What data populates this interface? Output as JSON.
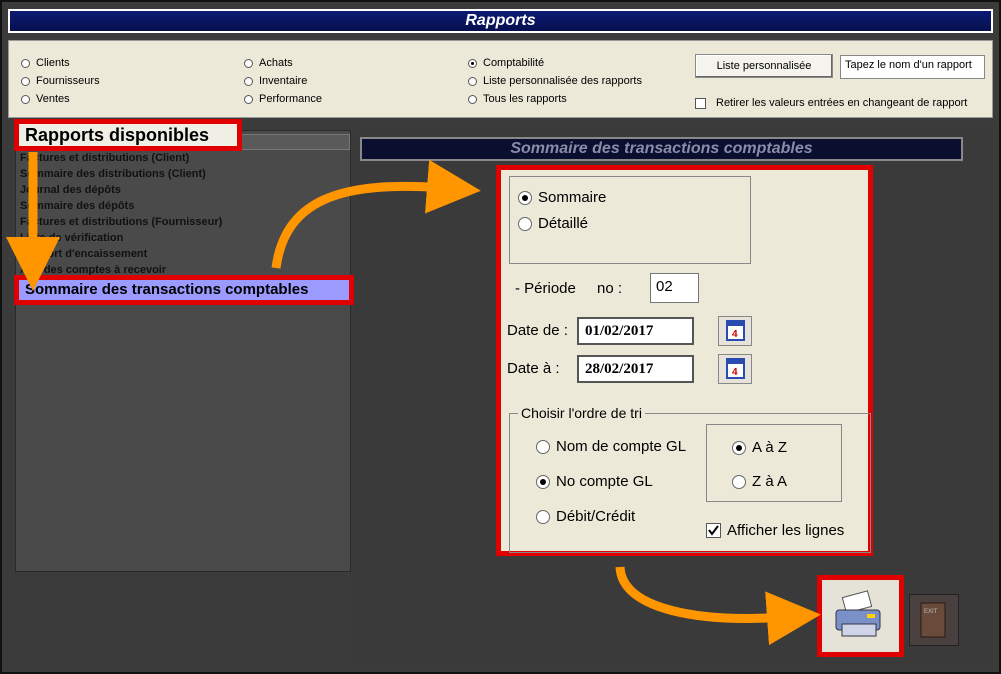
{
  "window": {
    "title": "Rapports"
  },
  "report_types": {
    "col1": [
      "Clients",
      "Fournisseurs",
      "Ventes"
    ],
    "col2": [
      "Achats",
      "Inventaire",
      "Performance"
    ],
    "col3": [
      "Comptabilité",
      "Liste personnalisée des rapports",
      "Tous les rapports"
    ],
    "selected": "Comptabilité"
  },
  "toolbar": {
    "liste_label": "Liste personnalisée",
    "input_value": "Tapez le nom d'un rapport",
    "retirer_label": "Retirer les valeurs entrées en changeant de rapport"
  },
  "reports": {
    "heading": "Rapports disponibles",
    "items": [
      "Factures et distributions (Client)",
      "Sommaire des distributions (Client)",
      "Journal des dépôts",
      "Sommaire des dépôts",
      "Factures et distributions (Fournisseur)",
      "Liste de vérification",
      "Rapport d'encaissement",
      "Âge des comptes à recevoir"
    ],
    "selected": "Sommaire des transactions comptables"
  },
  "panel": {
    "header": "Sommaire des transactions comptables",
    "mode": {
      "sommaire": "Sommaire",
      "detaille": "Détaillé",
      "selected": "Sommaire"
    },
    "periode_label": "- Période",
    "no_label": "no :",
    "periode_value": "02",
    "date_de_label": "Date de :",
    "date_de_value": "01/02/2017",
    "date_a_label": "Date à :",
    "date_a_value": "28/02/2017",
    "tri": {
      "legend": "Choisir l'ordre de tri",
      "options": [
        "Nom de compte GL",
        "No compte GL",
        "Débit/Crédit"
      ],
      "selected": "No compte GL",
      "order": [
        "A à Z",
        "Z à A"
      ],
      "order_selected": "A à Z"
    },
    "afficher_label": "Afficher les lignes",
    "afficher_checked": true
  },
  "colors": {
    "highlight": "#e00000",
    "arrow": "#ff9600",
    "title_bg": "#0c1a73",
    "selected_item_bg": "#9a9aff"
  },
  "icons": [
    "printer-icon",
    "exit-icon",
    "calendar-icon"
  ]
}
